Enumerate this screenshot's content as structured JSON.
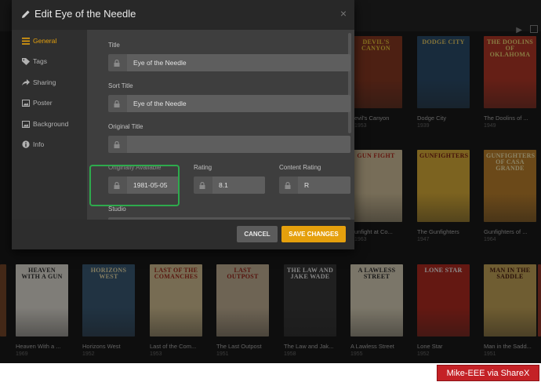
{
  "modal": {
    "title": "Edit Eye of the Needle",
    "close_glyph": "×"
  },
  "nav": [
    {
      "label": "General",
      "icon": "list-icon",
      "active": true
    },
    {
      "label": "Tags",
      "icon": "tag-icon",
      "active": false
    },
    {
      "label": "Sharing",
      "icon": "share-icon",
      "active": false
    },
    {
      "label": "Poster",
      "icon": "image-icon",
      "active": false
    },
    {
      "label": "Background",
      "icon": "image-icon",
      "active": false
    },
    {
      "label": "Info",
      "icon": "info-icon",
      "active": false
    }
  ],
  "form": {
    "title_label": "Title",
    "title_value": "Eye of the Needle",
    "sort_title_label": "Sort Title",
    "sort_title_value": "Eye of the Needle",
    "original_title_label": "Original Title",
    "original_title_value": "",
    "originally_available_label": "Originally Available",
    "originally_available_value": "1981-05-05",
    "rating_label": "Rating",
    "rating_value": "8.1",
    "content_rating_label": "Content Rating",
    "content_rating_value": "R",
    "studio_label": "Studio"
  },
  "buttons": {
    "cancel": "CANCEL",
    "save": "SAVE CHANGES"
  },
  "library": {
    "row1": [
      {
        "title": "Devil's Canyon",
        "caption": "evil's Canyon",
        "year": "1953",
        "poster_text": "DEVIL'S CANYON",
        "bg": "#8d3b24",
        "fg": "#f3d03b"
      },
      {
        "title": "Dodge City",
        "caption": "Dodge City",
        "year": "1939",
        "poster_text": "DODGE CITY",
        "bg": "#2d4f6e",
        "fg": "#f0d36a"
      },
      {
        "title": "The Doolins of Oklahoma",
        "caption": "The Doolins of ...",
        "year": "1949",
        "poster_text": "THE DOOLINS OF OKLAHOMA",
        "bg": "#b83a28",
        "fg": "#f7e07a"
      }
    ],
    "row2": [
      {
        "title": "Gunfight at Comanche Creek",
        "caption": "unfight at Co...",
        "year": "1963",
        "poster_text": "GUN FIGHT",
        "bg": "#d9c7a0",
        "fg": "#b42a1d"
      },
      {
        "title": "The Gunfighters",
        "caption": "The Gunfighters",
        "year": "1947",
        "poster_text": "GUNFIGHTERS",
        "bg": "#e2b43b",
        "fg": "#7b1e12"
      },
      {
        "title": "Gunfighters of Casa Grande",
        "caption": "Gunfighters of ...",
        "year": "1964",
        "poster_text": "GUNFIGHTERS OF CASA GRANDE",
        "bg": "#c4862f",
        "fg": "#fff0b8"
      }
    ],
    "row3": [
      {
        "title": "Heaven With a Gun",
        "caption": "Heaven With a ...",
        "year": "1969",
        "poster_text": "HEAVEN WITH A GUN",
        "bg": "#e8e4db",
        "fg": "#303030"
      },
      {
        "title": "Horizons West",
        "caption": "Horizons West",
        "year": "1952",
        "poster_text": "HORIZONS WEST",
        "bg": "#3c5d79",
        "fg": "#f1e3b0"
      },
      {
        "title": "Last of the Comanches",
        "caption": "Last of the Com...",
        "year": "1953",
        "poster_text": "LAST OF THE COMANCHES",
        "bg": "#d9c597",
        "fg": "#a32a1c"
      },
      {
        "title": "The Last Outpost",
        "caption": "The Last Outpost",
        "year": "1951",
        "poster_text": "LAST OUTPOST",
        "bg": "#c9b79a",
        "fg": "#9d2418"
      },
      {
        "title": "The Law and Jake Wade",
        "caption": "The Law and Jak...",
        "year": "1958",
        "poster_text": "THE LAW AND JAKE WADE",
        "bg": "#3b3b3b",
        "fg": "#f4f4f4"
      },
      {
        "title": "A Lawless Street",
        "caption": "A Lawless Street",
        "year": "1955",
        "poster_text": "A LAWLESS STREET",
        "bg": "#e1d8bf",
        "fg": "#2b2b2b"
      },
      {
        "title": "Lone Star",
        "caption": "Lone Star",
        "year": "1952",
        "poster_text": "LONE STAR",
        "bg": "#b62d22",
        "fg": "#ffffff"
      },
      {
        "title": "Man in the Saddle",
        "caption": "Man in the Sadd...",
        "year": "1951",
        "poster_text": "MAN IN THE SADDLE",
        "bg": "#caa95b",
        "fg": "#4a1d10"
      }
    ],
    "edge_left": {
      "bg": "#7a4a2a"
    },
    "edge_right": {
      "bg": "#9b3a2a"
    }
  },
  "watermark": "Mike-EEE via ShareX"
}
